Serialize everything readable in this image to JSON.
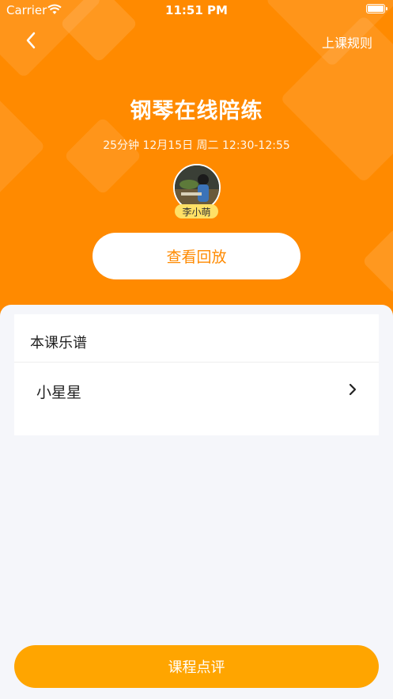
{
  "status_bar": {
    "carrier": "Carrier",
    "time": "11:51 PM"
  },
  "header": {
    "rules_label": "上课规则",
    "title": "钢琴在线陪练",
    "lesson_info": "25分钟 12月15日 周二 12:30-12:55",
    "teacher_name": "李小萌",
    "replay_button": "查看回放"
  },
  "scores_card": {
    "title": "本课乐谱",
    "items": [
      {
        "label": "小星星"
      }
    ]
  },
  "footer": {
    "comment_button": "课程点评"
  },
  "colors": {
    "accent": "#ff8a00",
    "button": "#ffa500",
    "background": "#f5f6fa"
  }
}
